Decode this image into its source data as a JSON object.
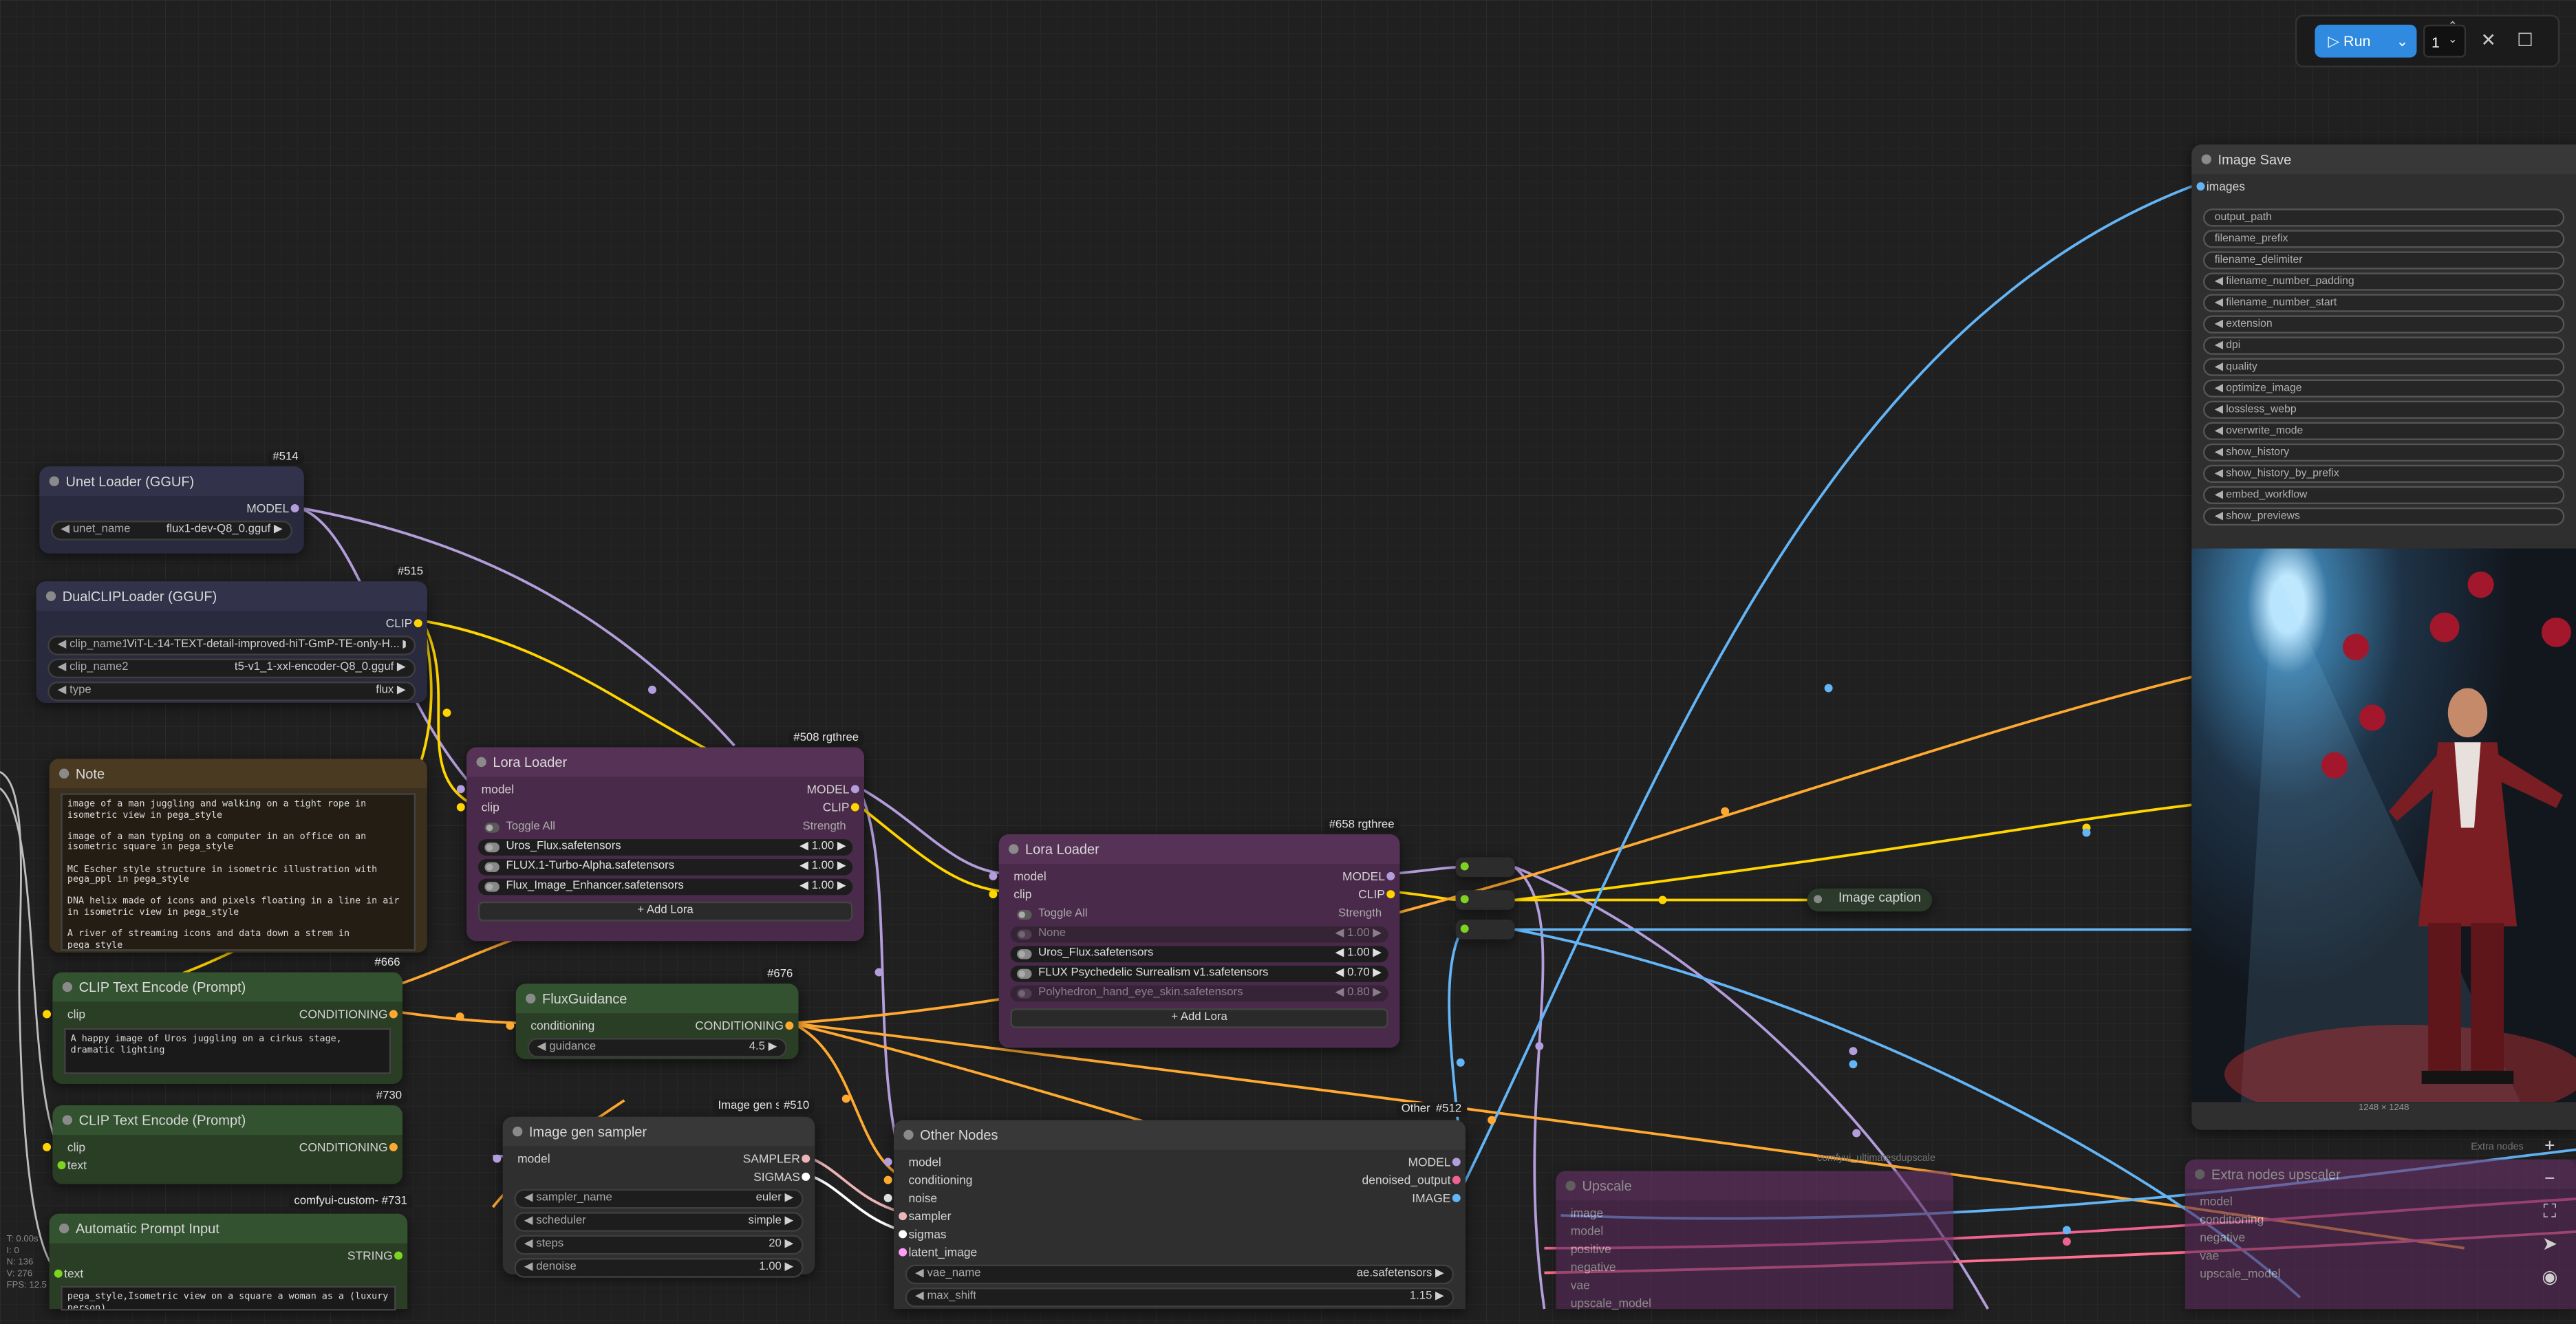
{
  "toolbar": {
    "run_label": "Run",
    "batch_count": "1"
  },
  "nodes": {
    "unet": {
      "title": "Unet Loader (GGUF)",
      "id": "#514",
      "out_model": "MODEL",
      "w_label": "unet_name",
      "w_value": "flux1-dev-Q8_0.gguf"
    },
    "dualclip": {
      "title": "DualCLIPLoader (GGUF)",
      "id": "#515",
      "out_clip": "CLIP",
      "widgets": [
        {
          "label": "clip_name1",
          "value": "ViT-L-14-TEXT-detail-improved-hiT-GmP-TE-only-H..."
        },
        {
          "label": "clip_name2",
          "value": "t5-v1_1-xxl-encoder-Q8_0.gguf"
        },
        {
          "label": "type",
          "value": "flux"
        }
      ]
    },
    "note": {
      "title": "Note",
      "text": "image of a man juggling and walking on a tight rope in isometric view in pega_style\n\nimage of a man typing on a computer in an office on an isometric square in pega_style\n\nMC Escher style structure in isometric illustration with pega_ppl in pega_style\n\nDNA helix made of icons and pixels floating in a line in air in isometric view in pega_style\n\nA river of streaming icons and data down a strem in pega_style"
    },
    "lora1": {
      "title": "Lora Loader",
      "id": "#508 rgthree",
      "in_model": "model",
      "in_clip": "clip",
      "out_model": "MODEL",
      "out_clip": "CLIP",
      "toggle_all": "Toggle All",
      "strength": "Strength",
      "add": "+ Add Lora",
      "loras": [
        {
          "name": "Uros_Flux.safetensors",
          "strength": "1.00"
        },
        {
          "name": "FLUX.1-Turbo-Alpha.safetensors",
          "strength": "1.00"
        },
        {
          "name": "Flux_Image_Enhancer.safetensors",
          "strength": "1.00"
        }
      ]
    },
    "lora2": {
      "title": "Lora Loader",
      "id": "#658 rgthree",
      "in_model": "model",
      "in_clip": "clip",
      "out_model": "MODEL",
      "out_clip": "CLIP",
      "toggle_all": "Toggle All",
      "strength": "Strength",
      "add": "+ Add Lora",
      "loras": [
        {
          "name": "None",
          "strength": "1.00",
          "off": true
        },
        {
          "name": "Uros_Flux.safetensors",
          "strength": "1.00"
        },
        {
          "name": "FLUX Psychedelic Surrealism v1.safetensors",
          "strength": "0.70"
        },
        {
          "name": "Polyhedron_hand_eye_skin.safetensors",
          "strength": "0.80",
          "off": true
        }
      ]
    },
    "clip1": {
      "title": "CLIP Text Encode (Prompt)",
      "id": "#666",
      "in_clip": "clip",
      "out": "CONDITIONING",
      "text": "A happy image of Uros juggling on a cirkus stage, dramatic lighting"
    },
    "clip2": {
      "title": "CLIP Text Encode (Prompt)",
      "id": "#730",
      "in_clip": "clip",
      "in_text": "text",
      "out": "CONDITIONING"
    },
    "fluxg": {
      "title": "FluxGuidance",
      "id": "#676",
      "in": "conditioning",
      "out": "CONDITIONING",
      "w_label": "guidance",
      "w_value": "4.5"
    },
    "autoprompt": {
      "title": "Automatic Prompt Input",
      "id": "comfyui-custom-  #731",
      "in": "text",
      "out": "STRING",
      "text": "pega_style,Isometric view on a square a woman as a (luxury person)"
    },
    "sampler": {
      "title": "Image gen sampler",
      "id_group": "Image gen s",
      "id": "#510",
      "in_model": "model",
      "out_sampler": "SAMPLER",
      "out_sigmas": "SIGMAS",
      "widgets": [
        {
          "label": "sampler_name",
          "value": "euler"
        },
        {
          "label": "scheduler",
          "value": "simple"
        },
        {
          "label": "steps",
          "value": "20"
        },
        {
          "label": "denoise",
          "value": "1.00"
        }
      ]
    },
    "other": {
      "title": "Other Nodes",
      "id_group": "Other",
      "id": "#512",
      "inputs": [
        "model",
        "conditioning",
        "noise",
        "sampler",
        "sigmas",
        "latent_image"
      ],
      "outputs": [
        "MODEL",
        "denoised_output",
        "IMAGE"
      ],
      "widgets": [
        {
          "label": "vae_name",
          "value": "ae.safetensors"
        },
        {
          "label": "max_shift",
          "value": "1.15"
        }
      ]
    },
    "caption": {
      "title": "Image caption"
    },
    "save": {
      "title": "Image Save",
      "in": "images",
      "fields": [
        "output_path",
        "filename_prefix",
        "filename_delimiter",
        "filename_number_padding",
        "filename_number_start",
        "extension",
        "dpi",
        "quality",
        "optimize_image",
        "lossless_webp",
        "overwrite_mode",
        "show_history",
        "show_history_by_prefix",
        "embed_workflow",
        "show_previews"
      ],
      "preview_size": "1248 × 1248"
    },
    "upscale": {
      "title": "Upscale",
      "tag": "comfyui_ultimatesdupscale",
      "rows": [
        "image",
        "model",
        "positive",
        "negative",
        "vae",
        "upscale_model"
      ]
    },
    "extra": {
      "title": "Extra nodes upscaler",
      "tag": "Extra nodes",
      "rows": [
        "model",
        "conditioning",
        "negative",
        "vae",
        "upscale_model"
      ]
    }
  },
  "stats": [
    "T: 0.00s",
    "I: 0",
    "N: 136",
    "V: 276",
    "FPS: 12.5"
  ],
  "colors": {
    "model": "#b39ddb",
    "clip": "#ffd500",
    "conditioning": "#ffa931",
    "image": "#64b5f6",
    "sampler": "#ecb4b4",
    "run": "#2f8ae0"
  }
}
